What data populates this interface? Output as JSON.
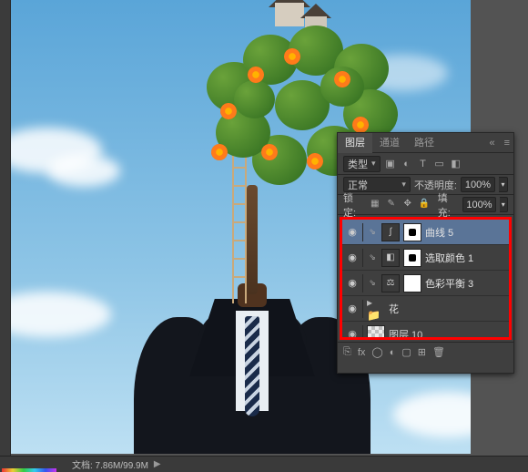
{
  "panel": {
    "tabs": [
      "图层",
      "通道",
      "路径"
    ],
    "activeTab": 0,
    "kindLabel": "类型",
    "blendMode": "正常",
    "opacityLabel": "不透明度:",
    "opacityValue": "100%",
    "lockLabel": "锁定:",
    "fillLabel": "填充:",
    "fillValue": "100%"
  },
  "layers": [
    {
      "name": "曲线 5",
      "selected": true,
      "type": "adjustment",
      "icon": "curves",
      "clippedBelow": true
    },
    {
      "name": "选取颜色 1",
      "selected": false,
      "type": "adjustment",
      "icon": "selective-color",
      "clippedBelow": true
    },
    {
      "name": "色彩平衡 3",
      "selected": false,
      "type": "adjustment",
      "icon": "color-balance",
      "clippedBelow": true
    },
    {
      "name": "花",
      "selected": false,
      "type": "group"
    },
    {
      "name": "图层 10",
      "selected": false,
      "type": "raster"
    }
  ],
  "status": {
    "docInfo": "文档: 7.86M/99.9M"
  },
  "icons": {
    "eye": "◉",
    "chevron": "▾",
    "menu": "≡",
    "close": "«",
    "link": "⇘",
    "folder": "▸ 📁",
    "curves": "∫",
    "selcolor": "◧",
    "colorbal": "⚖",
    "lock_trans": "▦",
    "lock_brush": "✎",
    "lock_move": "✥",
    "lock_all": "🔒",
    "fx": "fx",
    "mask_ico": "◯",
    "adj_ico": "◐",
    "group_ico": "▢",
    "new_ico": "⊞",
    "trash": "🗑",
    "link2": "⎘",
    "filter_img": "▣",
    "filter_adj": "◐",
    "filter_txt": "T",
    "filter_shape": "▭",
    "filter_smart": "◧"
  }
}
